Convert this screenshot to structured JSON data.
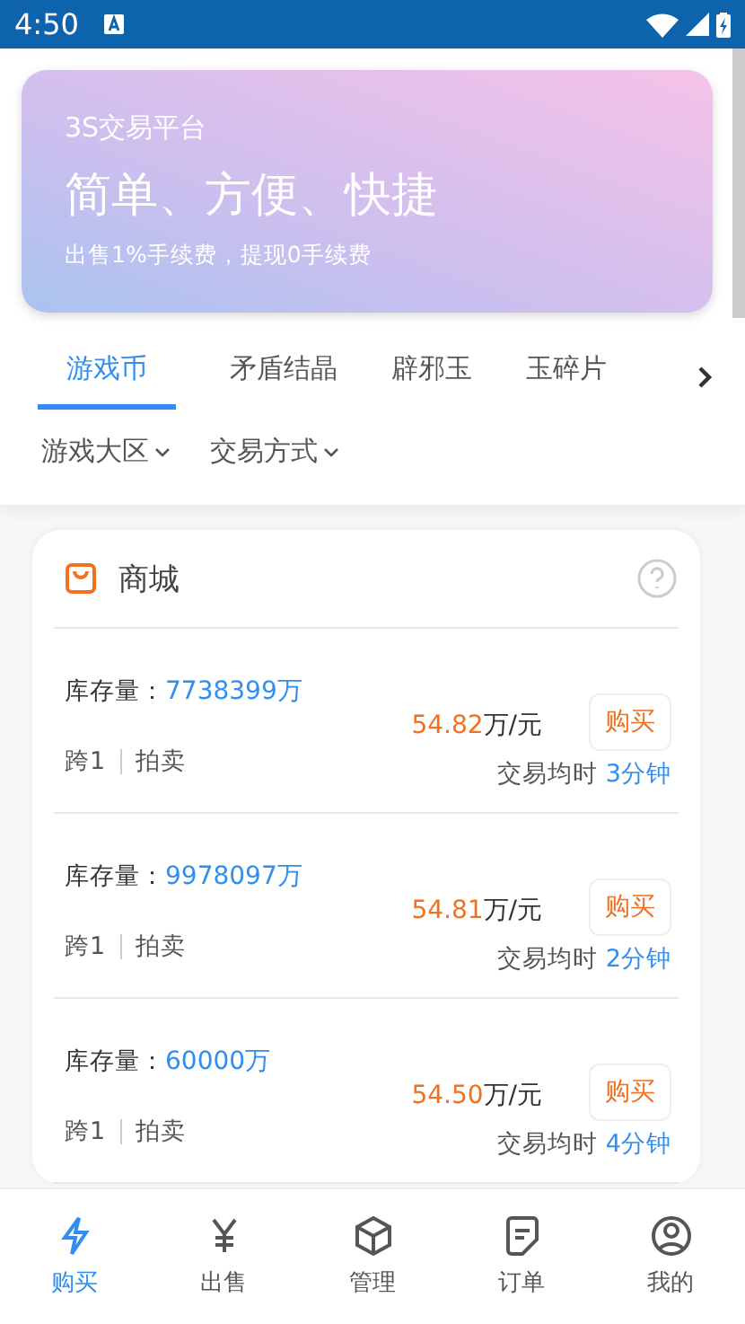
{
  "status_bar": {
    "time": "4:50"
  },
  "banner": {
    "title": "3S交易平台",
    "headline": "简单、方便、快捷",
    "subtitle": "出售1%手续费，提现0手续费"
  },
  "category_tabs": [
    {
      "label": "游戏币",
      "selected": true
    },
    {
      "label": "矛盾结晶",
      "selected": false
    },
    {
      "label": "辟邪玉",
      "selected": false
    },
    {
      "label": "玉碎片",
      "selected": false
    }
  ],
  "filters": [
    "游戏大区",
    "交易方式"
  ],
  "shop": {
    "title": "商城",
    "listings": [
      {
        "stock_label": "库存量：",
        "stock": "7738399万",
        "server": "跨1",
        "mode": "拍卖",
        "price": "54.82",
        "unit": "万/元",
        "buy": "购买",
        "time_label": "交易均时",
        "time": "3分钟"
      },
      {
        "stock_label": "库存量：",
        "stock": "9978097万",
        "server": "跨1",
        "mode": "拍卖",
        "price": "54.81",
        "unit": "万/元",
        "buy": "购买",
        "time_label": "交易均时",
        "time": "2分钟"
      },
      {
        "stock_label": "库存量：",
        "stock": "60000万",
        "server": "跨1",
        "mode": "拍卖",
        "price": "54.50",
        "unit": "万/元",
        "buy": "购买",
        "time_label": "交易均时",
        "time": "4分钟"
      }
    ]
  },
  "bottom_nav": [
    {
      "label": "购买",
      "kind": "buy",
      "selected": true
    },
    {
      "label": "出售",
      "kind": "sell",
      "selected": false
    },
    {
      "label": "管理",
      "kind": "manage",
      "selected": false
    },
    {
      "label": "订单",
      "kind": "orders",
      "selected": false
    },
    {
      "label": "我的",
      "kind": "profile",
      "selected": false
    }
  ]
}
